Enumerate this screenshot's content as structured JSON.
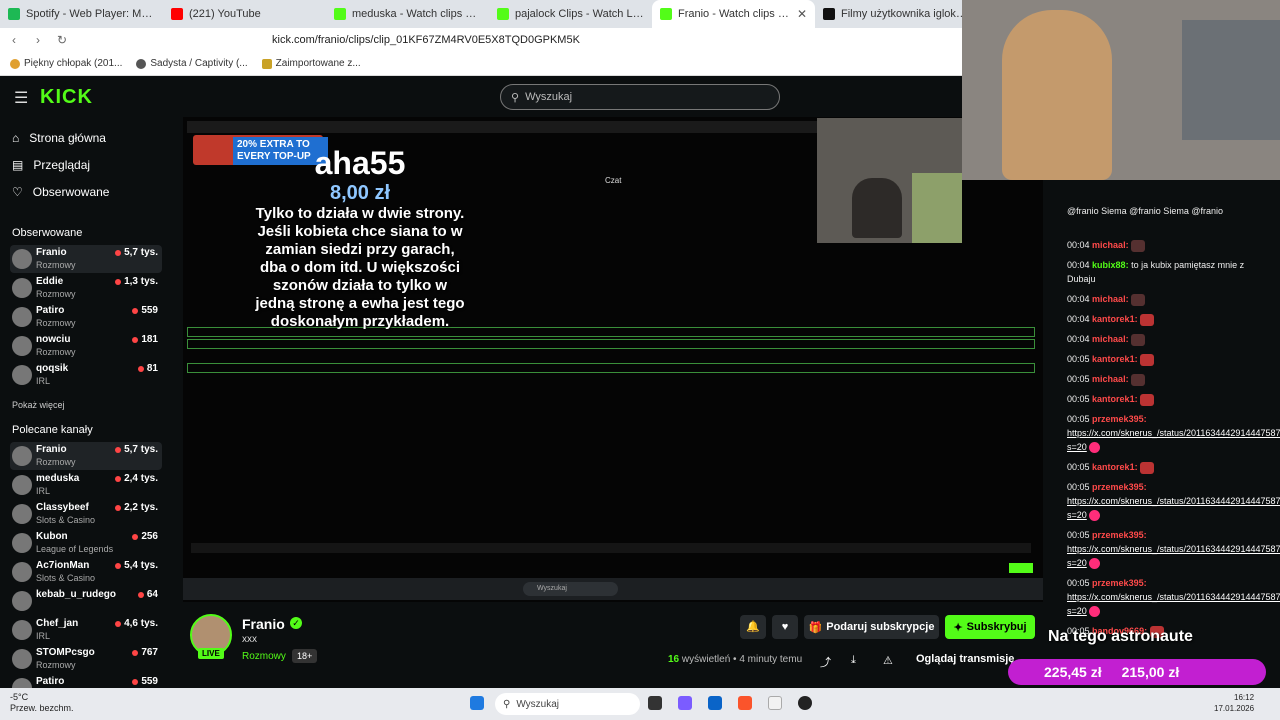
{
  "browser": {
    "tabs": [
      {
        "title": "Spotify - Web Player: Music for every",
        "color": "#1db954",
        "active": false
      },
      {
        "title": "(221) YouTube",
        "color": "#ff0000",
        "active": false
      },
      {
        "title": "meduska - Watch clips on Kick",
        "color": "#53fc18",
        "active": false
      },
      {
        "title": "pajalock Clips - Watch Live on Kick",
        "color": "#53fc18",
        "active": false
      },
      {
        "title": "Franio - Watch clips on Kick",
        "color": "#53fc18",
        "active": true
      },
      {
        "title": "Filmy użytkownika iglokalnyseba (",
        "color": "#111111",
        "active": false
      }
    ],
    "url": "kick.com/franio/clips/clip_01KF67ZM4RV0E5X8TQD0GPKM5K",
    "bookmarks": [
      "Piękny chłopak (201...",
      "Sadysta / Captivity (...",
      "Zaimportowane z..."
    ]
  },
  "kick": {
    "logo": "KICK",
    "search_placeholder": "Wyszukaj"
  },
  "sidebar": {
    "nav": [
      {
        "label": "Strona główna",
        "icon": "home-icon"
      },
      {
        "label": "Przeglądaj",
        "icon": "browse-icon"
      },
      {
        "label": "Obserwowane",
        "icon": "heart-icon"
      }
    ],
    "followed_title": "Obserwowane",
    "followed": [
      {
        "name": "Franio",
        "category": "Rozmowy",
        "viewers": "5,7 tys."
      },
      {
        "name": "Eddie",
        "category": "Rozmowy",
        "viewers": "1,3 tys."
      },
      {
        "name": "Patiro",
        "category": "Rozmowy",
        "viewers": "559"
      },
      {
        "name": "nowciu",
        "category": "Rozmowy",
        "viewers": "181"
      },
      {
        "name": "qoqsik",
        "category": "IRL",
        "viewers": "81"
      }
    ],
    "show_more": "Pokaż więcej",
    "recommended_title": "Polecane kanały",
    "recommended": [
      {
        "name": "Franio",
        "category": "Rozmowy",
        "viewers": "5,7 tys."
      },
      {
        "name": "meduska",
        "category": "IRL",
        "viewers": "2,4 tys."
      },
      {
        "name": "Classybeef",
        "category": "Slots & Casino",
        "viewers": "2,2 tys."
      },
      {
        "name": "Kubon",
        "category": "League of Legends",
        "viewers": "256"
      },
      {
        "name": "Ac7ionMan",
        "category": "Slots & Casino",
        "viewers": "5,4 tys."
      },
      {
        "name": "kebab_u_rudego",
        "category": "",
        "viewers": "64"
      },
      {
        "name": "Chef_jan",
        "category": "IRL",
        "viewers": "4,6 tys."
      },
      {
        "name": "STOMPcsgo",
        "category": "Rozmowy",
        "viewers": "767"
      },
      {
        "name": "Patiro",
        "category": "",
        "viewers": "559"
      }
    ]
  },
  "video": {
    "promo": "20% EXTRA TO EVERY TOP-UP",
    "donor": "aha55",
    "amount": "8,00 zł",
    "message": "Tylko to działa w dwie strony. Jeśli kobieta chce siana to w zamian siedzi przy garach, dba o dom itd. U większości szonów działa to tylko w jedną stronę a ewha jest tego doskonałym przykładem.",
    "inner_chat_label": "Czat",
    "inner_search": "Wyszukaj"
  },
  "channel": {
    "name": "Franio",
    "title": "xxx",
    "category": "Rozmowy",
    "age": "18+",
    "live": "LIVE",
    "gift_label": "Podaruj subskrypcje",
    "subscribe_label": "Subskrybuj",
    "views_count": "16",
    "views_label": "wyświetleń",
    "time_ago": "4 minuty temu",
    "watch_label": "Oglądaj transmisję"
  },
  "chat": {
    "messages": [
      {
        "time": "",
        "user": "",
        "color": "#ffffff",
        "text": "@franio Siema @franio Siema @franio"
      },
      {
        "time": "00:04",
        "user": "michaal:",
        "color": "#ff4a4a",
        "text": ""
      },
      {
        "time": "00:04",
        "user": "kubix88:",
        "color": "#53fc18",
        "text": "to ja kubix pamiętasz mnie z Dubaju"
      },
      {
        "time": "00:04",
        "user": "michaal:",
        "color": "#ff4a4a",
        "text": ""
      },
      {
        "time": "00:04",
        "user": "kantorek1:",
        "color": "#ff4a4a",
        "text": ""
      },
      {
        "time": "00:04",
        "user": "michaal:",
        "color": "#ff4a4a",
        "text": ""
      },
      {
        "time": "00:05",
        "user": "kantorek1:",
        "color": "#ff4a4a",
        "text": ""
      },
      {
        "time": "00:05",
        "user": "michaal:",
        "color": "#ff4a4a",
        "text": ""
      },
      {
        "time": "00:05",
        "user": "kantorek1:",
        "color": "#ff4a4a",
        "text": ""
      },
      {
        "time": "00:05",
        "user": "przemek395:",
        "color": "#ff4a4a",
        "text": "https://x.com/sknerus_/status/2011634442914447587?s=20"
      },
      {
        "time": "00:05",
        "user": "kantorek1:",
        "color": "#ff4a4a",
        "text": ""
      },
      {
        "time": "00:05",
        "user": "przemek395:",
        "color": "#ff4a4a",
        "text": "https://x.com/sknerus_/status/2011634442914447587?s=20"
      },
      {
        "time": "00:05",
        "user": "przemek395:",
        "color": "#ff4a4a",
        "text": "https://x.com/sknerus_/status/2011634442914447587?s=20"
      },
      {
        "time": "00:05",
        "user": "przemek395:",
        "color": "#ff4a4a",
        "text": "https://x.com/sknerus_/status/2011634442914447587?s=20"
      },
      {
        "time": "00:05",
        "user": "bandov9669:",
        "color": "#ff4a4a",
        "text": ""
      }
    ]
  },
  "overlay": {
    "text": "Na tego astronaute",
    "amount1": "225,45 zł",
    "amount2": "215,00 zł"
  },
  "taskbar": {
    "temp": "-5°C",
    "weather": "Przew. bezchm.",
    "search": "Wyszukaj",
    "time": "16:12",
    "date": "17.01.2026"
  }
}
